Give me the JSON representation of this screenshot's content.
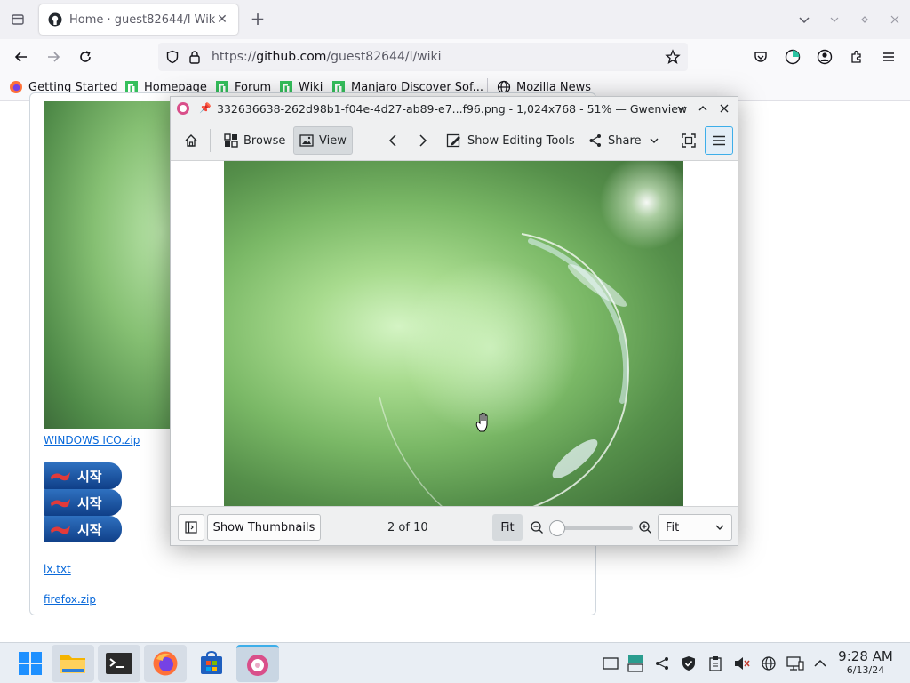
{
  "browser": {
    "tab_title": "Home · guest82644/l Wiki",
    "url_prefix": "https://",
    "url_host": "github.com",
    "url_path": "/guest82644/l/wiki",
    "bookmarks": [
      {
        "label": "Getting Started",
        "icon": "firefox-icon"
      },
      {
        "label": "Homepage",
        "icon": "manjaro-icon"
      },
      {
        "label": "Forum",
        "icon": "manjaro-icon"
      },
      {
        "label": "Wiki",
        "icon": "manjaro-icon"
      },
      {
        "label": "Manjaro Discover Sof...",
        "icon": "manjaro-icon"
      },
      {
        "label": "Mozilla News",
        "icon": "globe-icon"
      }
    ]
  },
  "page": {
    "links": {
      "windows_ico": "WINDOWS ICO.zip",
      "lx": "lx.txt",
      "firefox": "firefox.zip"
    },
    "start_button_label": "시작"
  },
  "gwenview": {
    "window_title": "332636638-262d98b1-f04e-4d27-ab89-e7...f96.png - 1,024x768 - 51% — Gwenview",
    "toolbar": {
      "browse": "Browse",
      "view": "View",
      "editing_tools": "Show Editing Tools",
      "share": "Share"
    },
    "status": {
      "show_thumbnails": "Show Thumbnails",
      "counter": "2 of 10",
      "fit_button": "Fit",
      "zoom_level": 0.0,
      "zoom_mode": "Fit"
    }
  },
  "taskbar": {
    "time": "9:28 AM",
    "date": "6/13/24",
    "colors": {
      "accent": "#3daee9"
    }
  }
}
